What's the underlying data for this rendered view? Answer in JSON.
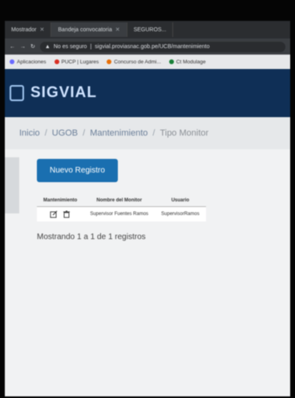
{
  "browser": {
    "tabs": [
      {
        "label": "Mostrador",
        "active": false
      },
      {
        "label": "Bandeja convocatoria",
        "active": true
      },
      {
        "label": "SEGUROS...",
        "active": false
      }
    ],
    "security_label": "No es seguro",
    "url": "sigvial.proviasnac.gob.pe/UCB/mantenimiento",
    "bookmarks": [
      {
        "label": "Aplicaciones",
        "color": "#6b6bff"
      },
      {
        "label": "PUCP | Lugares",
        "color": "#d93025"
      },
      {
        "label": "Concurso de Admi...",
        "color": "#e8710a"
      },
      {
        "label": "Ct Modulage",
        "color": "#188038"
      }
    ]
  },
  "header": {
    "brand": "SIGVIAL"
  },
  "breadcrumb": {
    "items": [
      "Inicio",
      "UGOB",
      "Mantenimiento"
    ],
    "current": "Tipo Monitor"
  },
  "main": {
    "new_button": "Nuevo Registro",
    "table": {
      "headers": [
        "Mantenimiento",
        "Nombre del Monitor",
        "Usuario"
      ],
      "rows": [
        {
          "name": "Supervisor Fuentes Ramos",
          "user": "SupervisorRamos"
        }
      ]
    },
    "footer": "Mostrando 1 a 1 de 1 registros"
  },
  "colors": {
    "header_bg": "#0f2f56",
    "button_bg": "#1a6fb0"
  }
}
